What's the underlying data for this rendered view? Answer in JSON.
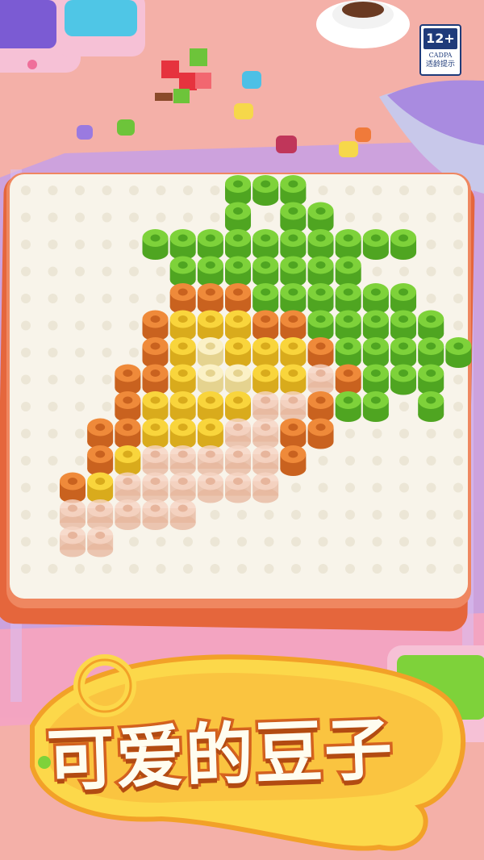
{
  "rating": {
    "age": "12+",
    "org": "CADPA",
    "label": "适龄提示"
  },
  "title": "可爱的豆子",
  "colors": {
    "background": "#f4b0a8",
    "board": "#f8f4ea",
    "board_frame": "#ec7b57",
    "green": "#7ed23a",
    "orange": "#ef8a3a",
    "yellow": "#f9d53c",
    "pale_yellow": "#fbf1c6",
    "peach": "#f6d5c4",
    "title_fill": "#fff7d0",
    "title_stroke": "#d7641f"
  },
  "pattern": {
    "legend": {
      "G": "green",
      "O": "orange",
      "Y": "yellow",
      "W": "pale_yellow",
      "P": "peach",
      ".": "empty"
    },
    "rows": [
      "......GGG.......",
      "......G.GG......",
      "...GGGGGGGGGG...",
      "....GGGGGGG.....",
      "....OOOGGGGGG...",
      "...OYYYOOGGGGG..",
      "...OYWYYYOGGGGG.",
      "..OOYWWYYPOGGG..",
      "..OYYYYPPOGG.G..",
      ".OOYYYPPOO......",
      ".OYPPPPPO.......",
      "OYPPPPPP........",
      "PPPPP...........",
      "PP..............",
      "................"
    ]
  }
}
